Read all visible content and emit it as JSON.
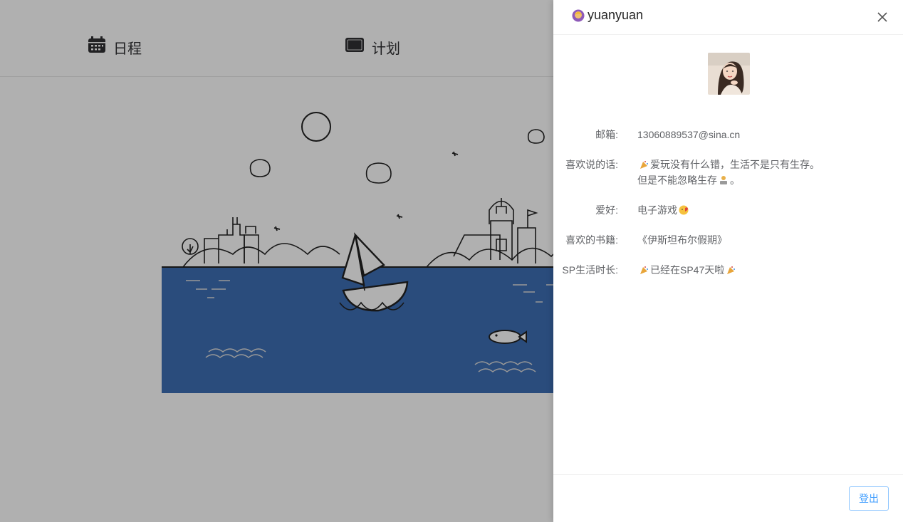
{
  "nav": {
    "items": [
      {
        "label": "日程",
        "icon": "calendar-icon"
      },
      {
        "label": "计划",
        "icon": "monitor-icon"
      }
    ]
  },
  "drawer": {
    "title": "yuanyuan",
    "title_icon": "user-emoji-icon",
    "close_icon": "close-icon",
    "fields": [
      {
        "label": "邮箱:",
        "value": "13060889537@sina.cn"
      },
      {
        "label": "喜欢说的话:",
        "value_line1": "爱玩没有什么错，生活不是只有生存。",
        "value_line2": "但是不能忽略生存",
        "value_line2_end": "。"
      },
      {
        "label": "爱好:",
        "value": "电子游戏"
      },
      {
        "label": "喜欢的书籍:",
        "value": "《伊斯坦布尔假期》"
      },
      {
        "label": "SP生活时长:",
        "value": "已经在SP47天啦"
      }
    ],
    "logout_label": "登出"
  },
  "colors": {
    "sea": "#3e6eb4",
    "overlay": "rgba(0,0,0,0.31)",
    "primary": "#409eff"
  }
}
